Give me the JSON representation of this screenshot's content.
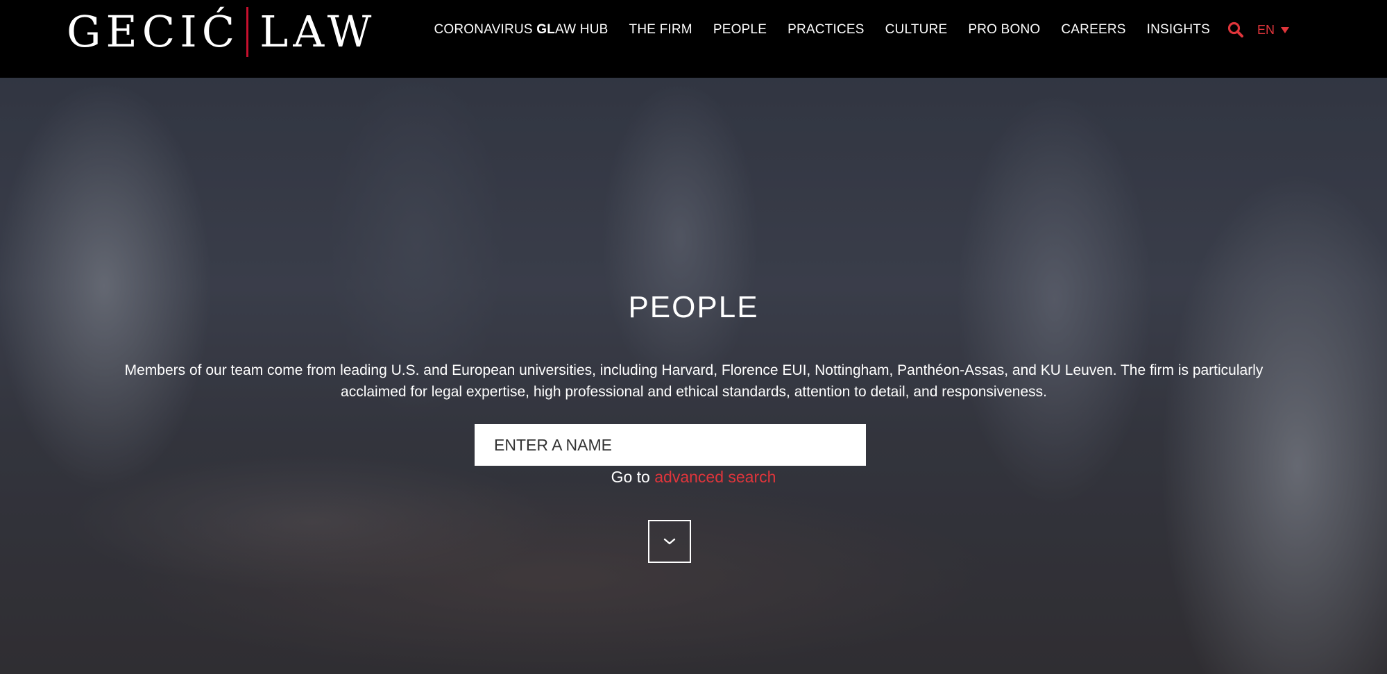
{
  "header": {
    "logo_left": "GECIĆ",
    "logo_right": "LAW",
    "nav": {
      "hub_prefix": "CORONAVIRUS ",
      "hub_bold": "GL",
      "hub_suffix": "AW HUB",
      "items": [
        "THE FIRM",
        "PEOPLE",
        "PRACTICES",
        "CULTURE",
        "PRO BONO",
        "CAREERS",
        "INSIGHTS"
      ]
    },
    "search_icon": "search-icon",
    "language": "EN"
  },
  "hero": {
    "title": "PEOPLE",
    "description": "Members of our team come from leading U.S. and European universities, including Harvard, Florence EUI, Nottingham, Panthéon-Assas, and KU Leuven. The firm is particularly acclaimed for legal expertise, high professional and ethical standards, attention to detail, and responsiveness.",
    "search_placeholder": "ENTER A NAME",
    "advanced_prefix": "Go to ",
    "advanced_link": "advanced search",
    "scroll_icon": "chevron-down-icon"
  },
  "colors": {
    "accent": "#e0353b",
    "header_bg": "#000000",
    "text": "#ffffff"
  }
}
